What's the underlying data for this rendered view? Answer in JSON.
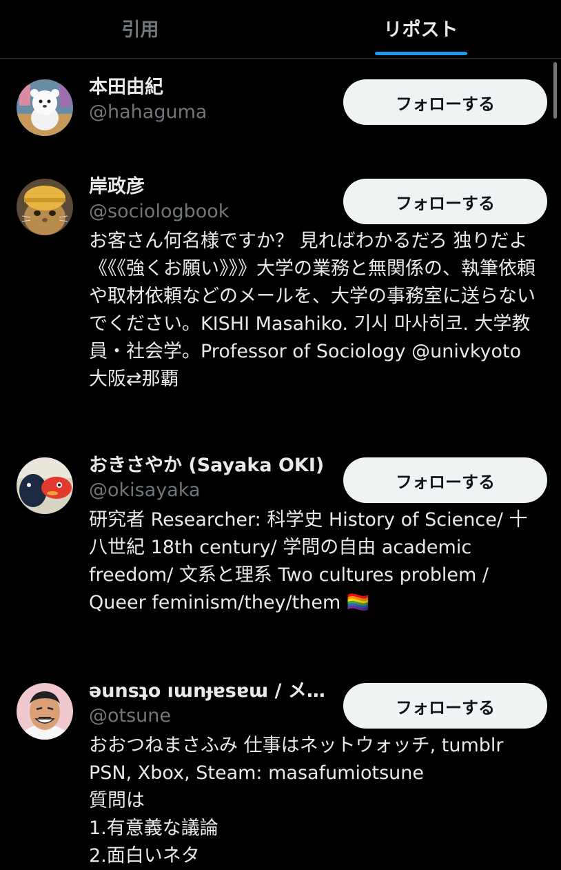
{
  "tabs": [
    {
      "label": "引用",
      "active": false
    },
    {
      "label": "リポスト",
      "active": true
    }
  ],
  "users": [
    {
      "name": "本田由紀",
      "handle": "@hahaguma",
      "bio": "",
      "follow_label": "フォローする",
      "avatar_icon": "bear-plush-avatar"
    },
    {
      "name": "岸政彦",
      "handle": "@sociologbook",
      "bio": "お客さん何名様ですか？ 見ればわかるだろ 独りだよ《《《強くお願い》》》大学の業務と無関係の、執筆依頼や取材依頼などのメールを、大学の事務室に送らないでください。KISHI Masahiko. 기시 마사히코. 大学教員・社会学。Professor of Sociology @univkyoto 大阪⇄那覇",
      "follow_label": "フォローする",
      "avatar_icon": "cat-with-helmet-avatar"
    },
    {
      "name": "おきさやか (Sayaka OKI)",
      "handle": "@okisayaka",
      "bio": "研究者 Researcher: 科学史 History of Science/ 十八世紀 18th century/ 学問の自由 academic freedom/ 文系と理系 Two cultures problem / Queer feminism/they/them 🏳️‍🌈",
      "follow_label": "フォローする",
      "avatar_icon": "plush-toys-avatar"
    },
    {
      "name": "ǝunsʇo ıɯnɟɐsɐɯ / メ…",
      "handle": "@otsune",
      "bio": "おおつねまさふみ 仕事はネットウォッチ, tumblr PSN, Xbox, Steam: masafumiotsune\n質問は\n1.有意義な議論\n2.面白いネタ",
      "follow_label": "フォローする",
      "avatar_icon": "cartoon-man-avatar"
    }
  ],
  "colors": {
    "background": "#000000",
    "accent": "#1d9bf0",
    "text_primary": "#e7e9ea",
    "text_secondary": "#71767b",
    "button_bg": "#eff3f4"
  }
}
